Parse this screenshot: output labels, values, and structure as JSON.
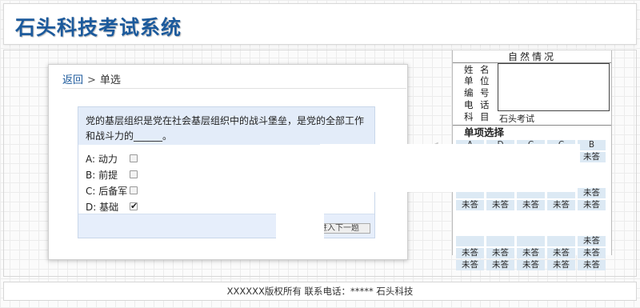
{
  "header": {
    "title": "石头科技考试系统"
  },
  "breadcrumb": {
    "back": "返回",
    "separator": ">",
    "current": "单选"
  },
  "question": {
    "text": "党的基层组织是党在社会基层组织中的战斗堡垒，是党的全部工作和战斗力的______。",
    "options": [
      {
        "label": "A: 动力",
        "checked": false
      },
      {
        "label": "B: 前提",
        "checked": false
      },
      {
        "label": "C: 后备军",
        "checked": false
      },
      {
        "label": "D: 基础",
        "checked": true
      }
    ],
    "submit_label": "提交并进入下一题"
  },
  "info_panel": {
    "title": "自然情况",
    "fields": [
      {
        "k1": "姓",
        "k2": "名"
      },
      {
        "k1": "单",
        "k2": "位"
      },
      {
        "k1": "编",
        "k2": "号"
      },
      {
        "k1": "电",
        "k2": "话"
      },
      {
        "k1": "科",
        "k2": "目"
      }
    ],
    "subject": "石头考试",
    "section_title": "单项选择",
    "grid_headers": [
      "A",
      "D",
      "C",
      "C",
      "B"
    ],
    "grid_rows": [
      [
        "",
        "",
        "",
        "",
        "未答"
      ],
      [
        "",
        "",
        "",
        "",
        "未答"
      ],
      [
        "未答",
        "未答",
        "未答",
        "未答",
        "未答"
      ],
      [
        "",
        "",
        "",
        "",
        "未答"
      ],
      [
        "未答",
        "未答",
        "未答",
        "未答",
        "未答"
      ],
      [
        "未答",
        "未答",
        "未答",
        "未答",
        "未答"
      ]
    ]
  },
  "footer": {
    "text": "XXXXXX版权所有 联系电话：***** 石头科技"
  }
}
